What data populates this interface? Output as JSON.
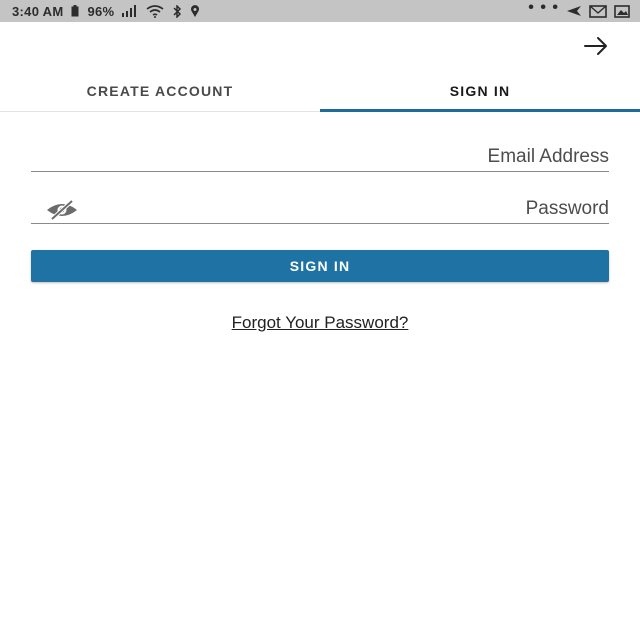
{
  "status_bar": {
    "time": "3:40 AM",
    "battery": "96%",
    "overflow": "• • •",
    "icons": [
      "location-icon",
      "bluetooth-icon",
      "wifi-icon",
      "signal-icon",
      "battery-icon",
      "send-icon",
      "mail-icon",
      "gallery-icon"
    ]
  },
  "header": {
    "action_icon": "arrow-right-icon"
  },
  "tabs": [
    {
      "label": "CREATE ACCOUNT",
      "active": false
    },
    {
      "label": "SIGN IN",
      "active": true
    }
  ],
  "form": {
    "email": {
      "placeholder": "Email Address",
      "value": ""
    },
    "password": {
      "placeholder": "Password",
      "value": "",
      "toggle_icon": "eye-off-icon"
    },
    "submit_label": "SIGN IN",
    "forgot_label": "Forgot Your Password?"
  },
  "colors": {
    "primary": "#1f72a4",
    "tab_indicator": "#1f6b9a",
    "status_bar": "#c4c4c4"
  }
}
